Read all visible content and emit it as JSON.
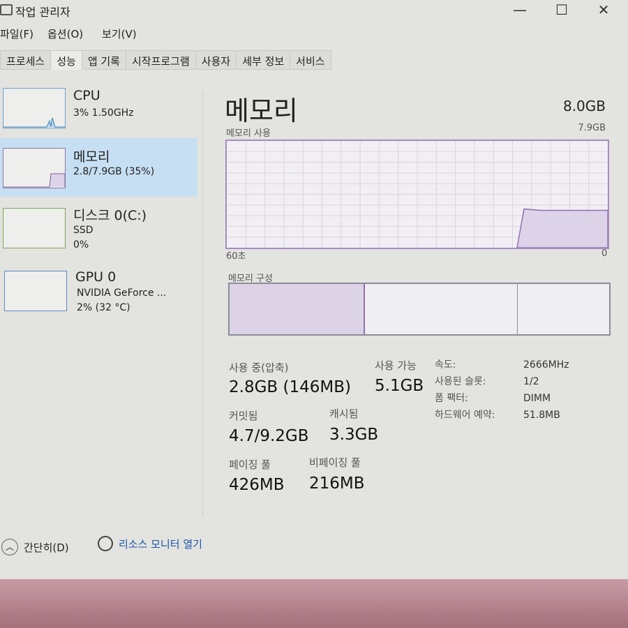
{
  "window": {
    "title": "작업 관리자",
    "controls": {
      "minimize": "—",
      "maximize": "☐",
      "close": "✕"
    }
  },
  "menu": [
    "파일(F)",
    "옵션(O)",
    "보기(V)"
  ],
  "tabs": [
    {
      "label": "프로세스"
    },
    {
      "label": "성능",
      "active": true
    },
    {
      "label": "앱 기록"
    },
    {
      "label": "시작프로그램"
    },
    {
      "label": "사용자"
    },
    {
      "label": "세부 정보"
    },
    {
      "label": "서비스"
    }
  ],
  "sidebar": [
    {
      "name": "CPU",
      "line1": "3% 1.50GHz",
      "line2": ""
    },
    {
      "name": "메모리",
      "line1": "2.8/7.9GB (35%)",
      "line2": "",
      "selected": true
    },
    {
      "name": "디스크 0(C:)",
      "line1": "SSD",
      "line2": "0%"
    },
    {
      "name": "GPU 0",
      "line1": "NVIDIA GeForce ...",
      "line2": "2% (32 °C)"
    }
  ],
  "main": {
    "title": "메모리",
    "total": "8.0GB",
    "usage_label": "메모리 사용",
    "usage_max": "7.9GB",
    "time_left": "60초",
    "time_right": "0",
    "usage_percent": 35,
    "composition_label": "메모리 구성",
    "stats": {
      "in_use_label": "사용 중(압축)",
      "in_use": "2.8GB (146MB)",
      "available_label": "사용 가능",
      "available": "5.1GB",
      "committed_label": "커밋됨",
      "committed": "4.7/9.2GB",
      "cached_label": "캐시됨",
      "cached": "3.3GB",
      "paged_label": "페이징 풀",
      "paged": "426MB",
      "nonpaged_label": "비페이징 풀",
      "nonpaged": "216MB"
    },
    "details": [
      {
        "k": "속도:",
        "v": "2666MHz"
      },
      {
        "k": "사용된 슬롯:",
        "v": "1/2"
      },
      {
        "k": "폼 팩터:",
        "v": "DIMM"
      },
      {
        "k": "하드웨어 예약:",
        "v": "51.8MB"
      }
    ]
  },
  "footer": {
    "fewer": "간단히(D)",
    "resmon": "리소스 모니터 열기"
  },
  "colors": {
    "accent": "#a58cc2",
    "selected": "#c7dff2"
  }
}
